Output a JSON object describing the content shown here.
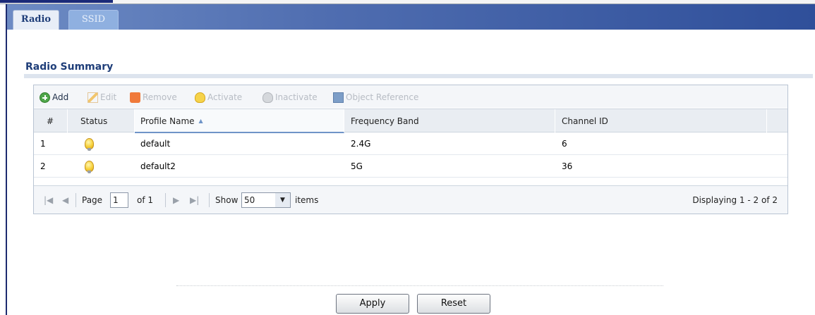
{
  "tabs": [
    {
      "label": "Radio"
    },
    {
      "label": "SSID"
    }
  ],
  "section": {
    "title": "Radio Summary"
  },
  "toolbar": {
    "add": "Add",
    "edit": "Edit",
    "remove": "Remove",
    "activate": "Activate",
    "inactivate": "Inactivate",
    "object_reference": "Object Reference"
  },
  "table": {
    "columns": [
      "#",
      "Status",
      "Profile Name",
      "Frequency Band",
      "Channel ID"
    ],
    "sorted_column": "Profile Name",
    "rows": [
      {
        "index": "1",
        "status": "active",
        "profile_name": "default",
        "frequency_band": "2.4G",
        "channel_id": "6"
      },
      {
        "index": "2",
        "status": "active",
        "profile_name": "default2",
        "frequency_band": "5G",
        "channel_id": "36"
      }
    ]
  },
  "pager": {
    "page_label": "Page",
    "page_value": "1",
    "of_label": "of 1",
    "show_label": "Show",
    "show_value": "50",
    "items_label": "items",
    "displaying": "Displaying 1 - 2 of 2"
  },
  "buttons": {
    "apply": "Apply",
    "reset": "Reset"
  },
  "colors": {
    "accent": "#1f3e79",
    "tab_bar": "#4f6db0",
    "bulb": "#f7d13a"
  }
}
